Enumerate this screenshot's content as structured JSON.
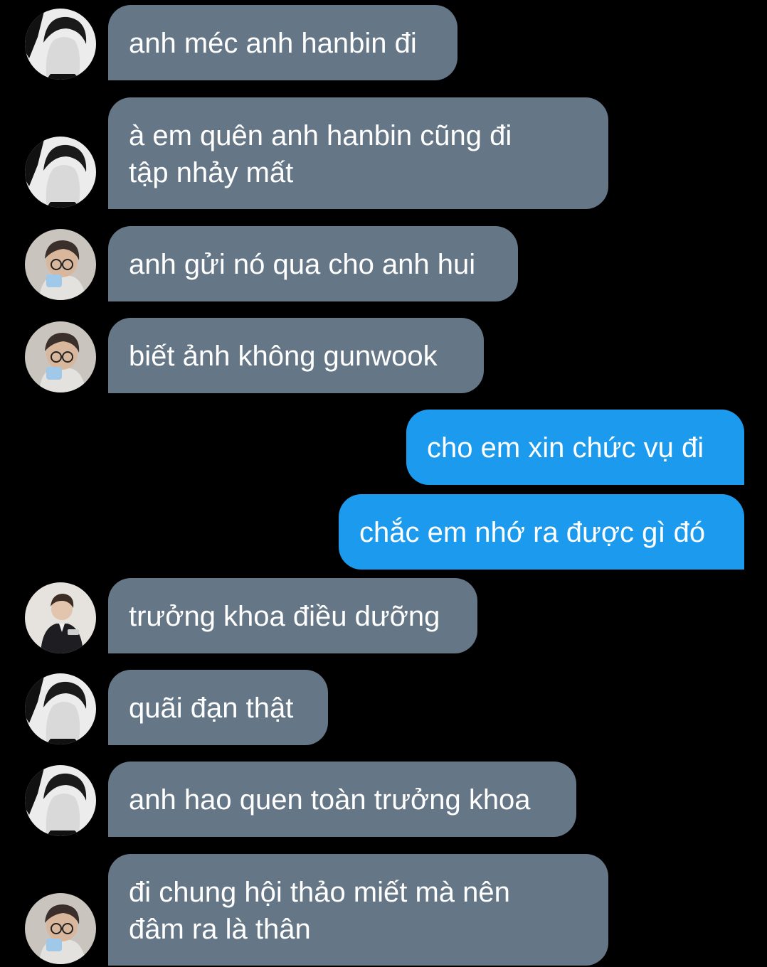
{
  "colors": {
    "background": "#000000",
    "incoming_bubble": "#657687",
    "outgoing_bubble": "#1c9bee",
    "text": "#ffffff"
  },
  "messages": [
    {
      "direction": "incoming",
      "sender_avatar": "avatar-bw",
      "text": "anh méc anh hanbin đi"
    },
    {
      "direction": "incoming",
      "sender_avatar": "avatar-bw",
      "text": "à em quên anh hanbin cũng đi tập nhảy mất"
    },
    {
      "direction": "incoming",
      "sender_avatar": "avatar-glasses",
      "text": "anh gửi nó qua cho anh hui"
    },
    {
      "direction": "incoming",
      "sender_avatar": "avatar-glasses",
      "text": "biết ảnh không gunwook"
    },
    {
      "direction": "outgoing",
      "text": "cho em xin chức vụ đi"
    },
    {
      "direction": "outgoing",
      "text": "chắc em nhớ ra được gì đó"
    },
    {
      "direction": "incoming",
      "sender_avatar": "avatar-suit",
      "text": "trưởng khoa điều dưỡng"
    },
    {
      "direction": "incoming",
      "sender_avatar": "avatar-bw",
      "text": "quãi đạn thật"
    },
    {
      "direction": "incoming",
      "sender_avatar": "avatar-bw",
      "text": "anh hao quen toàn trưởng khoa"
    },
    {
      "direction": "incoming",
      "sender_avatar": "avatar-glasses",
      "text": "đi chung hội thảo miết mà nên đâm ra là thân"
    }
  ]
}
